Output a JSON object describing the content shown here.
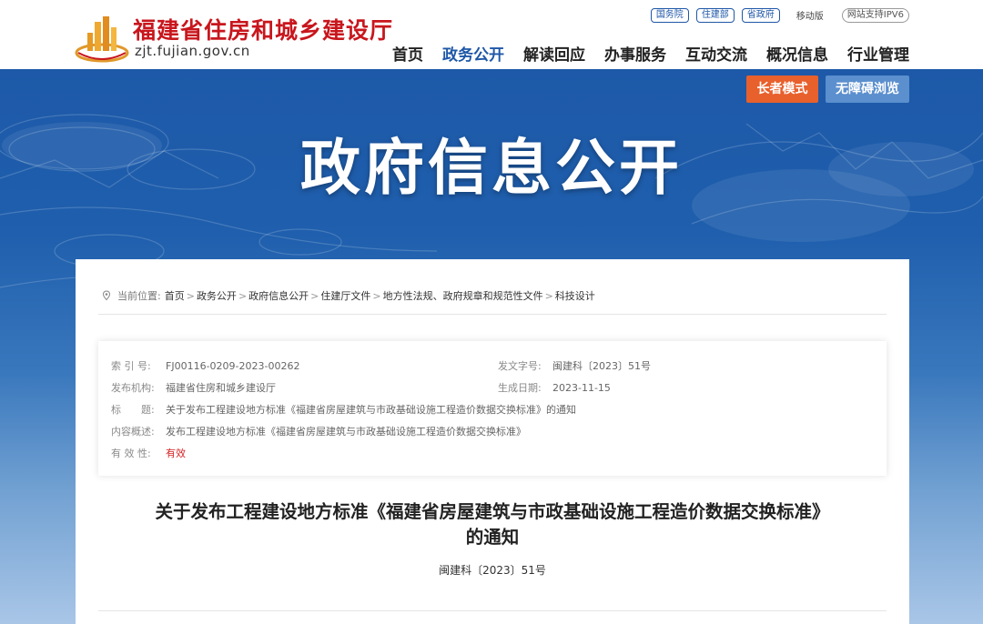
{
  "header": {
    "logo_title": "福建省住房和城乡建设厅",
    "logo_url": "zjt.fujian.gov.cn",
    "top_links": [
      "国务院",
      "住建部",
      "省政府"
    ],
    "mobile_label": "移动版",
    "ipv6_label": "网站支持IPV6",
    "nav": [
      "首页",
      "政务公开",
      "解读回应",
      "办事服务",
      "互动交流",
      "概况信息",
      "行业管理"
    ],
    "active_nav": "政务公开"
  },
  "banner": {
    "elder_mode": "长者模式",
    "accessible": "无障碍浏览",
    "title": "政府信息公开"
  },
  "breadcrumb": {
    "label": "当前位置:",
    "items": [
      "首页",
      "政务公开",
      "政府信息公开",
      "住建厅文件",
      "地方性法规、政府规章和规范性文件",
      "科技设计"
    ],
    "separator": ">"
  },
  "info": {
    "index_label": "索 引 号:",
    "index_value": "FJ00116-0209-2023-00262",
    "doc_no_label": "发文字号:",
    "doc_no_value": "闽建科〔2023〕51号",
    "org_label": "发布机构:",
    "org_value": "福建省住房和城乡建设厅",
    "date_label": "生成日期:",
    "date_value": "2023-11-15",
    "title_label": "标　　题:",
    "title_value": "关于发布工程建设地方标准《福建省房屋建筑与市政基础设施工程造价数据交换标准》的通知",
    "summary_label": "内容概述:",
    "summary_value": "发布工程建设地方标准《福建省房屋建筑与市政基础设施工程造价数据交换标准》",
    "valid_label": "有 效 性:",
    "valid_value": "有效"
  },
  "document": {
    "title_line1": "关于发布工程建设地方标准《福建省房屋建筑与市政基础设施工程造价数据交换标准》",
    "title_line2": "的通知",
    "number": "闽建科〔2023〕51号"
  },
  "colors": {
    "brand_red": "#c8161d",
    "nav_blue": "#1f57a7",
    "elder_orange": "#e8602c",
    "access_blue": "#5b8fce"
  }
}
